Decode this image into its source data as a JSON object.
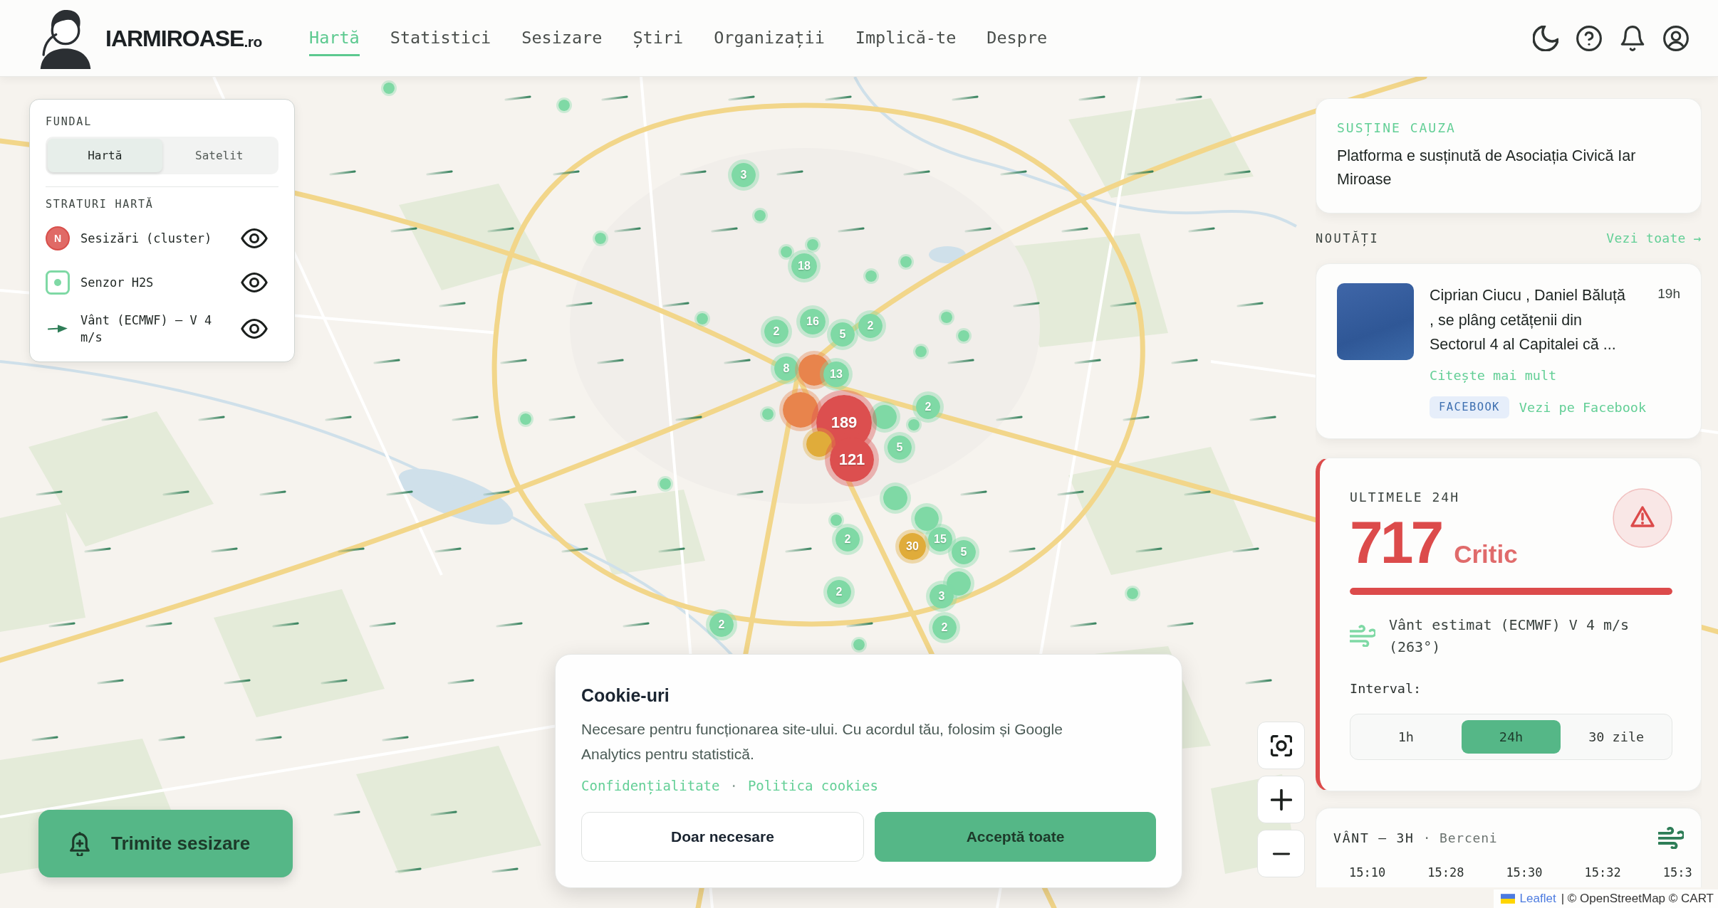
{
  "header": {
    "logo": {
      "name": "IARMIROASE",
      "suffix": ".ro"
    },
    "nav": [
      {
        "label": "Hartă",
        "selected": true
      },
      {
        "label": "Statistici",
        "selected": false
      },
      {
        "label": "Sesizare",
        "selected": false
      },
      {
        "label": "Știri",
        "selected": false
      },
      {
        "label": "Organizații",
        "selected": false
      },
      {
        "label": "Implică-te",
        "selected": false
      },
      {
        "label": "Despre",
        "selected": false
      }
    ]
  },
  "layers_panel": {
    "background_title": "FUNDAL",
    "background_options": [
      {
        "label": "Hartă",
        "selected": true
      },
      {
        "label": "Satelit",
        "selected": false
      }
    ],
    "layers_title": "STRATURI HARTĂ",
    "layers": [
      {
        "kind": "cluster",
        "icon_text": "N",
        "label": "Sesizări (cluster)",
        "visible": true
      },
      {
        "kind": "sensor",
        "label": "Senzor H2S",
        "visible": true
      },
      {
        "kind": "wind",
        "label": "Vânt (ECMWF) — V 4 m/s",
        "visible": true
      }
    ]
  },
  "map": {
    "markers": [
      {
        "kind": "point",
        "color": "#7fd9a5"
      },
      {
        "kind": "point",
        "color": "#7fd9a5"
      },
      {
        "kind": "point",
        "color": "#7fd9a5"
      },
      {
        "kind": "point",
        "color": "#7fd9a5"
      },
      {
        "kind": "point",
        "color": "#7fd9a5"
      },
      {
        "kind": "point",
        "color": "#7fd9a5"
      },
      {
        "kind": "point",
        "color": "#7fd9a5"
      },
      {
        "kind": "point",
        "color": "#7fd9a5"
      },
      {
        "kind": "point",
        "color": "#7fd9a5"
      },
      {
        "kind": "point",
        "color": "#7fd9a5"
      },
      {
        "kind": "point",
        "color": "#7fd9a5"
      },
      {
        "kind": "point",
        "color": "#7fd9a5"
      },
      {
        "kind": "point",
        "color": "#7fd9a5"
      },
      {
        "kind": "point",
        "color": "#7fd9a5"
      },
      {
        "kind": "point",
        "color": "#7fd9a5"
      },
      {
        "kind": "point",
        "color": "#7fd9a5"
      },
      {
        "kind": "point",
        "color": "#7fd9a5"
      },
      {
        "kind": "point",
        "color": "#7fd9a5"
      },
      {
        "kind": "point",
        "color": "#7fd9a5"
      },
      {
        "kind": "cluster",
        "count": "3",
        "color": "#7fd9a5"
      },
      {
        "kind": "cluster",
        "count": "18",
        "color": "#7fd9a5"
      },
      {
        "kind": "cluster",
        "count": "2",
        "color": "#7fd9a5"
      },
      {
        "kind": "cluster",
        "count": "16",
        "color": "#7fd9a5"
      },
      {
        "kind": "cluster",
        "count": "5",
        "color": "#7fd9a5"
      },
      {
        "kind": "cluster",
        "count": "2",
        "color": "#7fd9a5"
      },
      {
        "kind": "cluster",
        "count": "8",
        "color": "#7fd9a5"
      },
      {
        "kind": "covered",
        "color": "#e8844c"
      },
      {
        "kind": "cluster",
        "count": "13",
        "color": "#7fd9a5"
      },
      {
        "kind": "covered",
        "color": "#7fd9a5"
      },
      {
        "kind": "covered",
        "color": "#e8844c"
      },
      {
        "kind": "cluster",
        "count": "189",
        "color": "#dc4f4f"
      },
      {
        "kind": "covered",
        "color": "#e0ac3a"
      },
      {
        "kind": "covered",
        "color": "#7fd9a5"
      },
      {
        "kind": "cluster",
        "count": "121",
        "color": "#dc4f4f"
      },
      {
        "kind": "cluster",
        "count": "5",
        "color": "#7fd9a5"
      },
      {
        "kind": "cluster",
        "count": "2",
        "color": "#7fd9a5"
      },
      {
        "kind": "covered",
        "color": "#7fd9a5"
      },
      {
        "kind": "cluster",
        "count": "2",
        "color": "#7fd9a5"
      },
      {
        "kind": "cluster",
        "count": "15",
        "color": "#7fd9a5"
      },
      {
        "kind": "cluster",
        "count": "30",
        "color": "#e0ac3a"
      },
      {
        "kind": "cluster",
        "count": "5",
        "color": "#7fd9a5"
      },
      {
        "kind": "covered",
        "color": "#7fd9a5"
      },
      {
        "kind": "cluster",
        "count": "3",
        "color": "#7fd9a5"
      },
      {
        "kind": "cluster",
        "count": "2",
        "color": "#7fd9a5"
      },
      {
        "kind": "cluster",
        "count": "2",
        "color": "#7fd9a5"
      },
      {
        "kind": "cluster",
        "count": "2",
        "color": "#7fd9a5"
      }
    ]
  },
  "support_card": {
    "title": "SUSȚINE CAUZA",
    "text": "Platforma e susținută de Asociația Civică Iar Miroase"
  },
  "news": {
    "title": "NOUTĂȚI",
    "see_all": "Vezi toate →",
    "items": [
      {
        "text": "Ciprian Ciucu , Daniel Băluță , se plâng cetățenii din Sectorul 4 al Capitalei că ...",
        "time": "19h",
        "read_more": "Citește mai mult",
        "source": "FACEBOOK",
        "source_link": "Vezi pe Facebook"
      }
    ]
  },
  "status_card": {
    "title": "ULTIMELE 24H",
    "count": "717",
    "severity_label": "Critic",
    "level": 1,
    "wind": "Vânt estimat (ECMWF) V 4 m/s (263°)",
    "interval_label": "Interval:",
    "intervals": [
      {
        "label": "1h",
        "selected": false
      },
      {
        "label": "24h",
        "selected": true
      },
      {
        "label": "30 zile",
        "selected": false
      }
    ]
  },
  "wind_card": {
    "title": "VÂNT — 3H",
    "location": "· Berceni",
    "times": [
      "15:10",
      "15:28",
      "15:30",
      "15:32",
      "15:3"
    ]
  },
  "report_button": {
    "label": "Trimite sesizare"
  },
  "cookie_dialog": {
    "title": "Cookie-uri",
    "text": "Necesare pentru funcționarea site-ului. Cu acordul tău, folosim și Google Analytics pentru statistică.",
    "links": [
      "Confidențialitate",
      "Politica cookies"
    ],
    "separator": "·",
    "buttons": [
      {
        "kind": "secondary",
        "label": "Doar necesare"
      },
      {
        "kind": "primary",
        "label": "Acceptă toate"
      }
    ]
  },
  "attribution": {
    "link": "Leaflet",
    "text": "| © OpenStreetMap © CART"
  }
}
